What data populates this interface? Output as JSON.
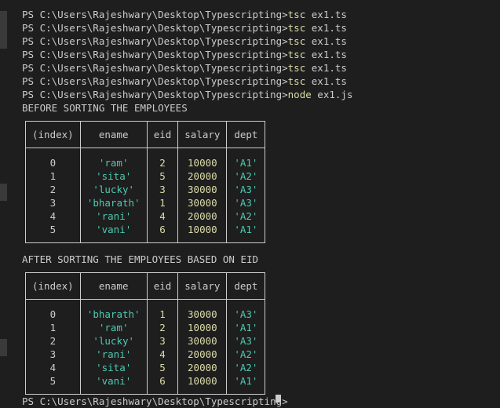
{
  "terminal": {
    "prompt": "PS C:\\Users\\Rajeshwary\\Desktop\\Typescripting>",
    "commands": [
      {
        "cmd": "tsc",
        "arg": "ex1.ts"
      },
      {
        "cmd": "tsc",
        "arg": "ex1.ts"
      },
      {
        "cmd": "tsc",
        "arg": "ex1.ts"
      },
      {
        "cmd": "tsc",
        "arg": "ex1.ts"
      },
      {
        "cmd": "tsc",
        "arg": "ex1.ts"
      },
      {
        "cmd": "tsc",
        "arg": "ex1.ts"
      },
      {
        "cmd": "node",
        "arg": "ex1.js"
      }
    ],
    "before_heading": "BEFORE SORTING THE EMPLOYEES",
    "after_heading": "AFTER SORTING THE EMPLOYEES BASED ON EID",
    "bottom_prompt": "PS C:\\Users\\Rajeshwary\\Desktop\\Typescripting>"
  },
  "table_headers": [
    "(index)",
    "ename",
    "eid",
    "salary",
    "dept"
  ],
  "before_rows": [
    {
      "index": "0",
      "ename": "'ram'",
      "eid": "2",
      "salary": "10000",
      "dept": "'A1'"
    },
    {
      "index": "1",
      "ename": "'sita'",
      "eid": "5",
      "salary": "20000",
      "dept": "'A2'"
    },
    {
      "index": "2",
      "ename": "'lucky'",
      "eid": "3",
      "salary": "30000",
      "dept": "'A3'"
    },
    {
      "index": "3",
      "ename": "'bharath'",
      "eid": "1",
      "salary": "30000",
      "dept": "'A3'"
    },
    {
      "index": "4",
      "ename": "'rani'",
      "eid": "4",
      "salary": "20000",
      "dept": "'A2'"
    },
    {
      "index": "5",
      "ename": "'vani'",
      "eid": "6",
      "salary": "10000",
      "dept": "'A1'"
    }
  ],
  "after_rows": [
    {
      "index": "0",
      "ename": "'bharath'",
      "eid": "1",
      "salary": "30000",
      "dept": "'A3'"
    },
    {
      "index": "1",
      "ename": "'ram'",
      "eid": "2",
      "salary": "10000",
      "dept": "'A1'"
    },
    {
      "index": "2",
      "ename": "'lucky'",
      "eid": "3",
      "salary": "30000",
      "dept": "'A3'"
    },
    {
      "index": "3",
      "ename": "'rani'",
      "eid": "4",
      "salary": "20000",
      "dept": "'A2'"
    },
    {
      "index": "4",
      "ename": "'sita'",
      "eid": "5",
      "salary": "20000",
      "dept": "'A2'"
    },
    {
      "index": "5",
      "ename": "'vani'",
      "eid": "6",
      "salary": "10000",
      "dept": "'A1'"
    }
  ],
  "colors": {
    "background": "#1e1e1e",
    "text": "#cccccc",
    "command": "#dcdcaa",
    "string": "#4ec9b0",
    "number": "#dcdcaa"
  }
}
